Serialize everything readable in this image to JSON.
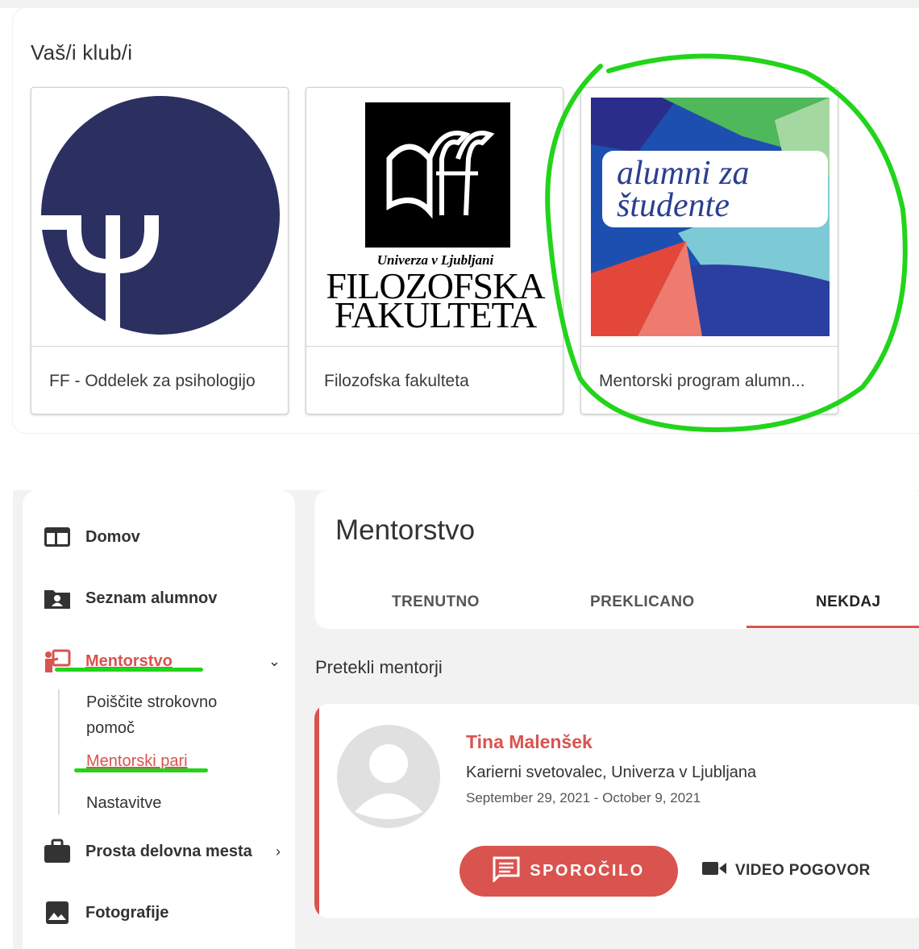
{
  "clubs": {
    "title": "Vaš/i klub/i",
    "items": [
      {
        "label": "FF - Oddelek za psihologijo",
        "logo": "psi-logo"
      },
      {
        "label": "Filozofska fakulteta",
        "logo": "ff-logo",
        "logo_text": [
          "Univerza v Ljubljani",
          "FILOZOFSKA",
          "FAKULTETA"
        ]
      },
      {
        "label": "Mentorski program alumn...",
        "logo": "alumni-za-studente-logo",
        "logo_text": [
          "alumni za",
          "študente"
        ]
      }
    ]
  },
  "sidebar": {
    "items": [
      {
        "label": "Domov",
        "icon": "home-dashboard-icon"
      },
      {
        "label": "Seznam alumnov",
        "icon": "contacts-folder-icon"
      },
      {
        "label": "Mentorstvo",
        "icon": "mentor-presentation-icon",
        "expanded": true
      },
      {
        "label": "Prosta delovna mesta",
        "icon": "briefcase-icon"
      },
      {
        "label": "Fotografije",
        "icon": "image-icon"
      }
    ],
    "sub_items": [
      {
        "label": "Poiščite strokovno pomoč"
      },
      {
        "label": "Mentorski pari"
      },
      {
        "label": "Nastavitve"
      }
    ]
  },
  "main": {
    "title": "Mentorstvo",
    "tabs": [
      {
        "label": "TRENUTNO"
      },
      {
        "label": "PREKLICANO"
      },
      {
        "label": "NEKDAJ"
      }
    ],
    "active_tab": "NEKDAJ",
    "section_title": "Pretekli mentorji",
    "mentor": {
      "name": "Tina Malenšek",
      "role": "Karierni svetovalec, Univerza v Ljubljana",
      "dates": "September 29, 2021 - October 9, 2021",
      "message_button": "SPOROČILO",
      "video_button": "VIDEO POGOVOR"
    }
  },
  "colors": {
    "accent": "#d9534f",
    "annotation": "#22d41a",
    "psi_navy": "#2b3061"
  }
}
